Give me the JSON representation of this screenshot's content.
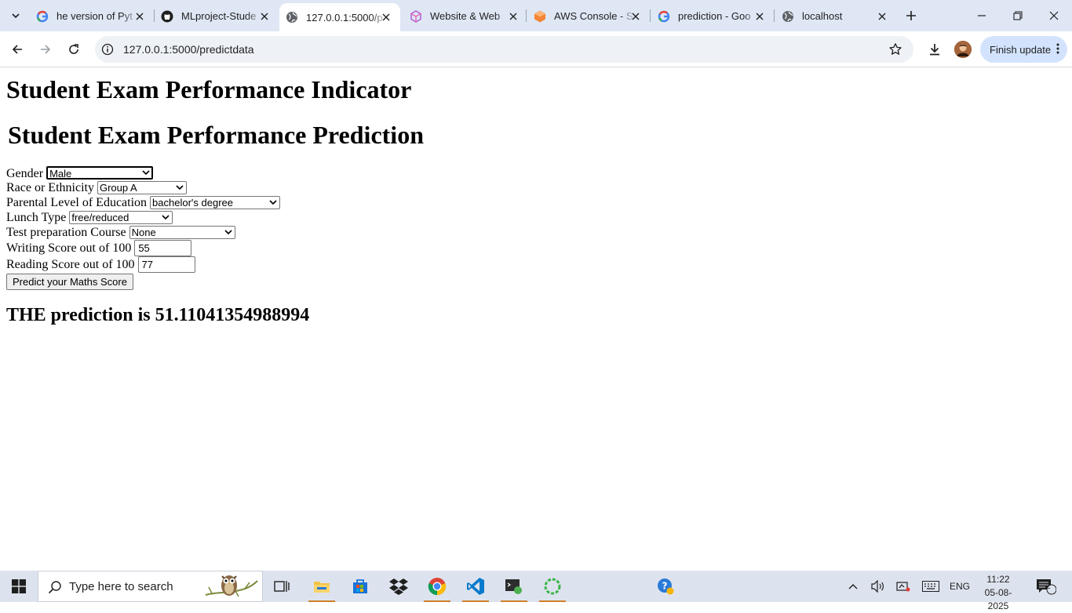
{
  "browser": {
    "tabs": [
      {
        "title": "he version of Pyt",
        "favicon": "google-icon"
      },
      {
        "title": "MLproject-Stude",
        "favicon": "github-icon"
      },
      {
        "title": "127.0.0.1:5000/p",
        "favicon": "globe-icon",
        "active": true
      },
      {
        "title": "Website & Web",
        "favicon": "cube-icon"
      },
      {
        "title": "AWS Console - S",
        "favicon": "aws-icon"
      },
      {
        "title": "prediction - Goo",
        "favicon": "google-icon"
      },
      {
        "title": "localhost",
        "favicon": "globe-icon"
      }
    ],
    "url": "127.0.0.1:5000/predictdata",
    "finish_update_label": "Finish update"
  },
  "page": {
    "heading": "Student Exam Performance Indicator",
    "subheading": "Student Exam Performance Prediction",
    "fields": {
      "gender": {
        "label": "Gender",
        "value": "Male"
      },
      "ethnicity": {
        "label": "Race or Ethnicity",
        "value": "Group A"
      },
      "parental_education": {
        "label": "Parental Level of Education",
        "value": "bachelor's degree"
      },
      "lunch": {
        "label": "Lunch Type",
        "value": "free/reduced"
      },
      "test_prep": {
        "label": "Test preparation Course",
        "value": "None"
      },
      "writing_score": {
        "label": "Writing Score out of 100",
        "value": "55"
      },
      "reading_score": {
        "label": "Reading Score out of 100",
        "value": "77"
      }
    },
    "submit_label": "Predict your Maths Score",
    "result_text": "THE prediction is 51.11041354988994"
  },
  "taskbar": {
    "search_placeholder": "Type here to search",
    "language": "ENG",
    "time": "11:22",
    "date": "05-08-2025",
    "notification_count": "2"
  },
  "colors": {
    "tabstrip_bg": "#dfe7f5",
    "finish_update_bg": "#d3e3fd",
    "taskbar_bg": "#dde3ee"
  }
}
